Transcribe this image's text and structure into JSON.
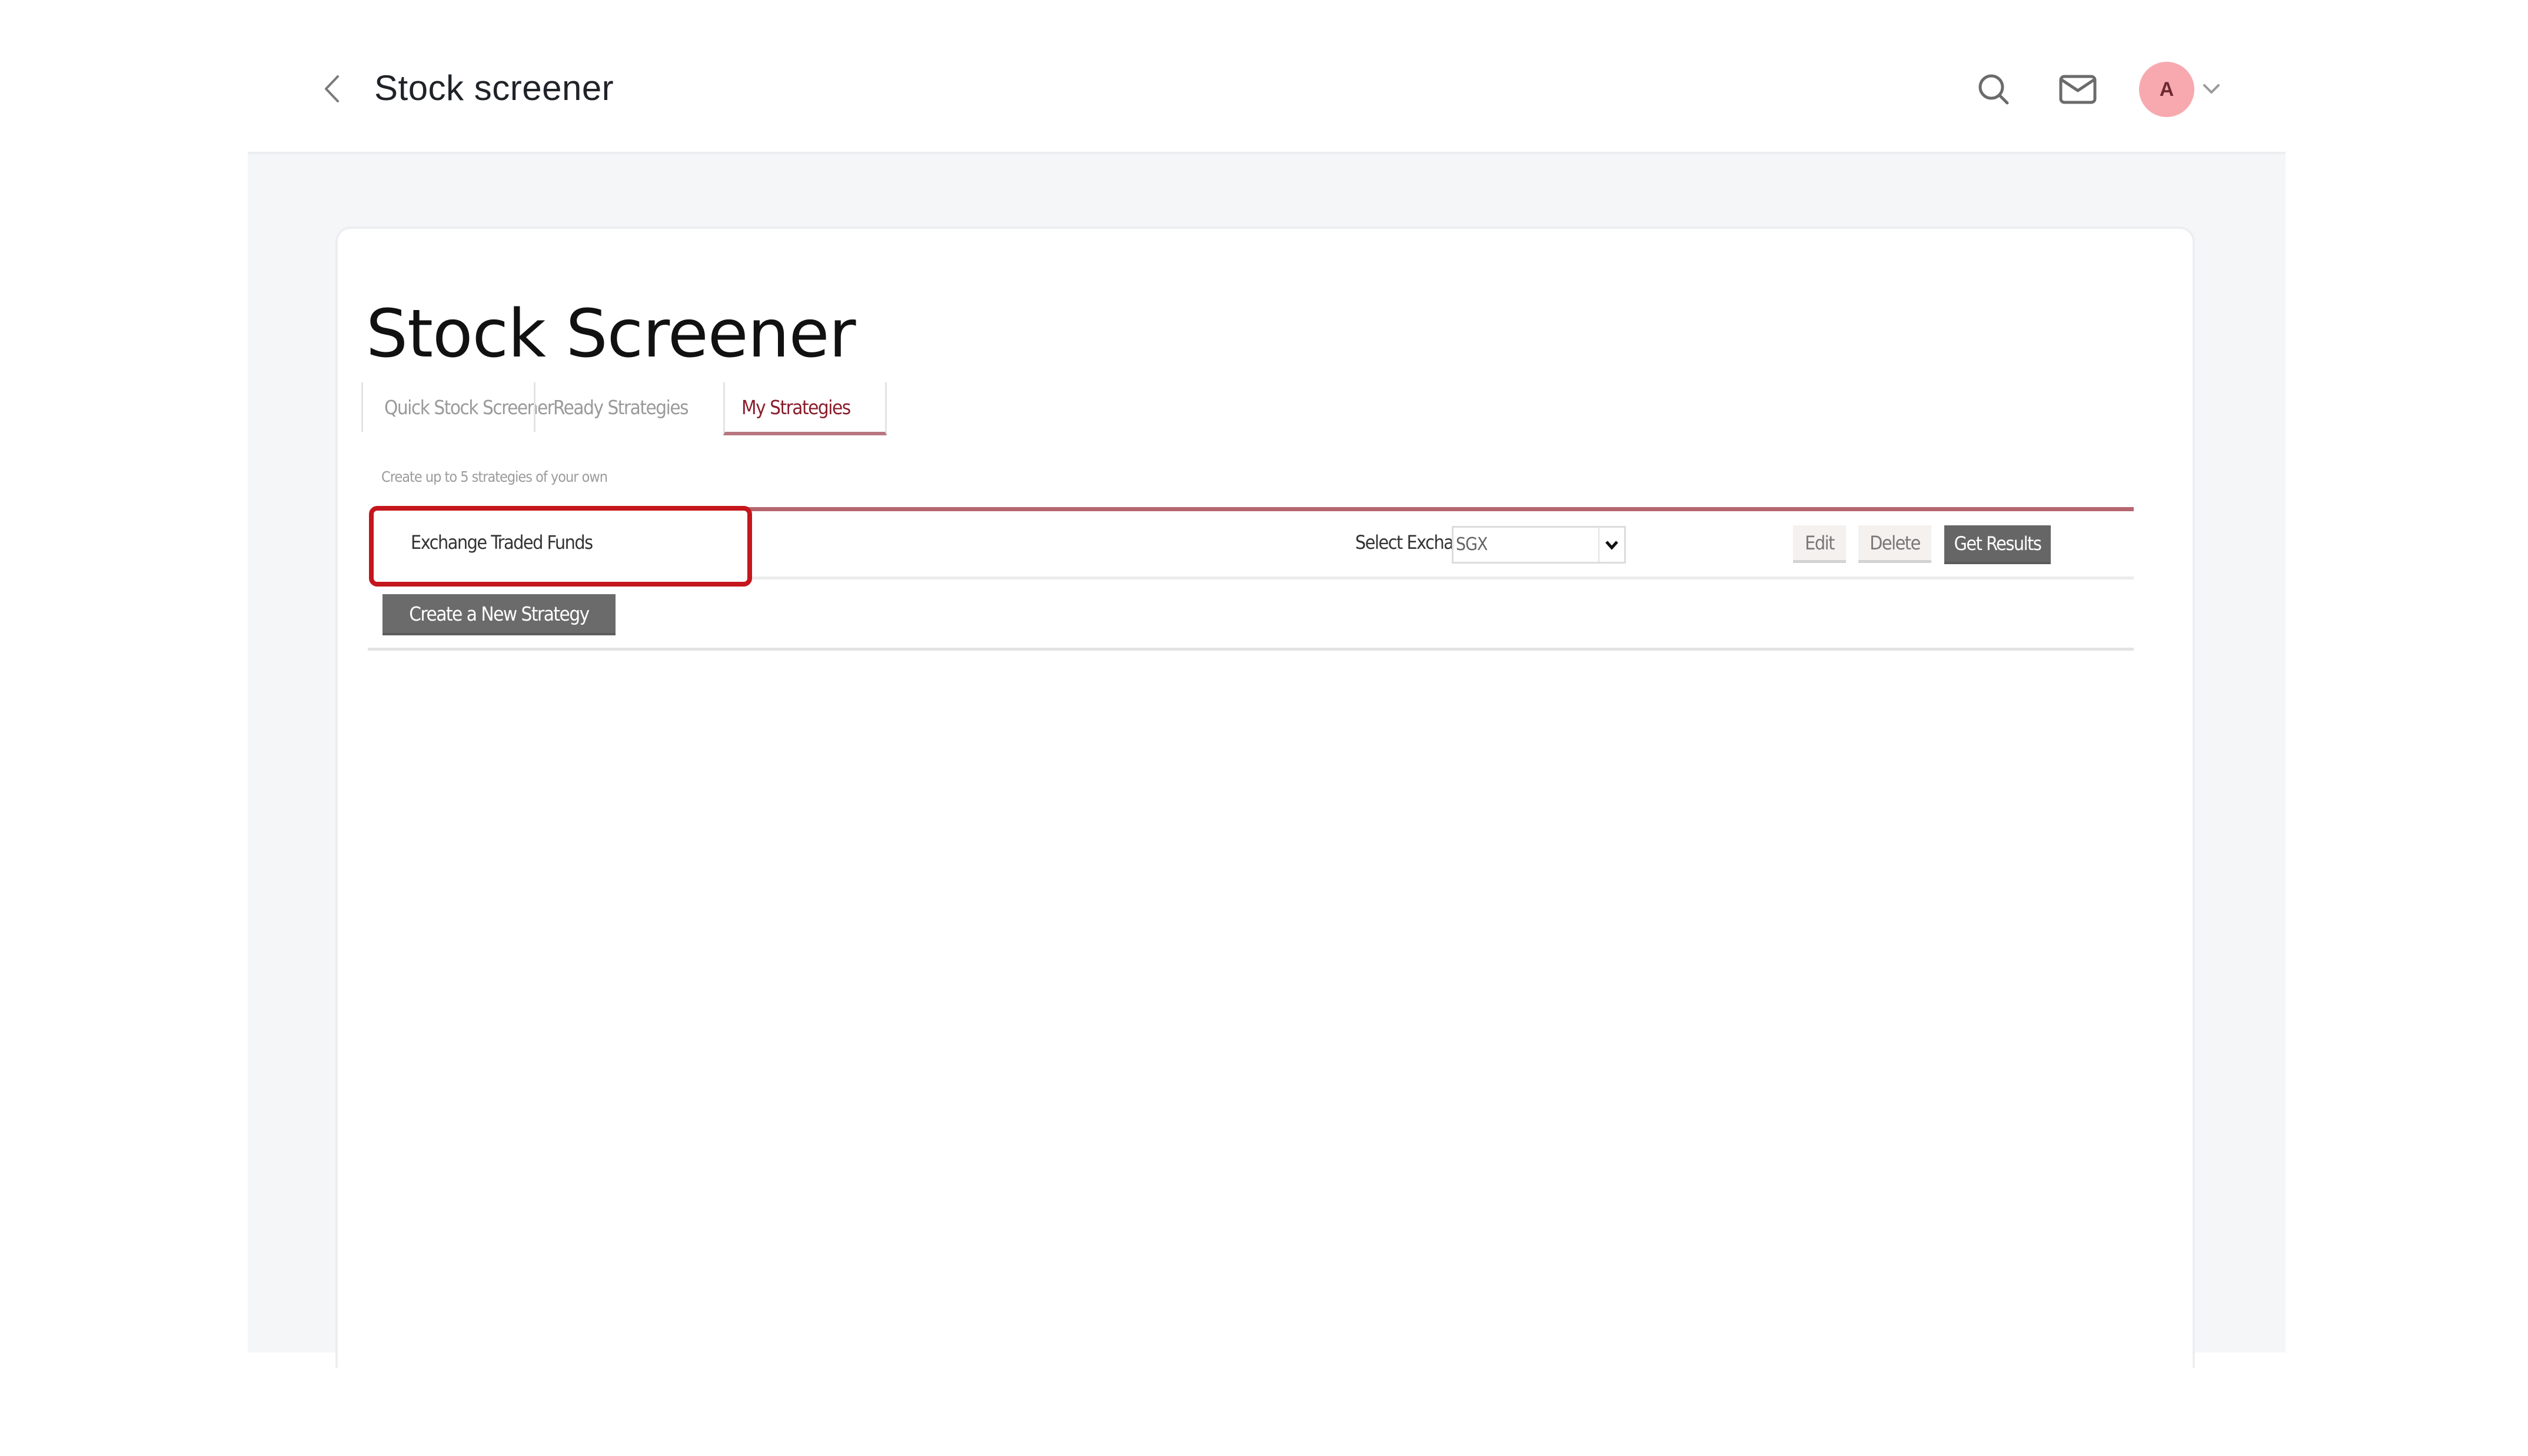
{
  "header": {
    "title": "Stock screener",
    "back_icon": "chevron-left-icon",
    "search_icon": "search-icon",
    "mail_icon": "mail-icon",
    "avatar_initial": "A",
    "avatar_color": "#f7a9af",
    "avatar_menu_icon": "chevron-down-icon"
  },
  "screener": {
    "title": "Stock Screener",
    "tabs": [
      {
        "label": "Quick Stock Screener",
        "active": false
      },
      {
        "label": "Ready Strategies",
        "active": false
      },
      {
        "label": "My Strategies",
        "active": true
      }
    ],
    "helper_text": "Create up to 5 strategies of your own",
    "strategies": [
      {
        "name": "Exchange Traded Funds",
        "highlighted": true
      }
    ],
    "exchange": {
      "label": "Select Exchange",
      "selected": "SGX"
    },
    "actions": {
      "edit": "Edit",
      "delete": "Delete",
      "get_results": "Get Results",
      "create_new": "Create a New Strategy"
    },
    "colors": {
      "highlight": "#c4161c",
      "active_tab": "#8a1d2c",
      "dark_button": "#666666"
    }
  }
}
